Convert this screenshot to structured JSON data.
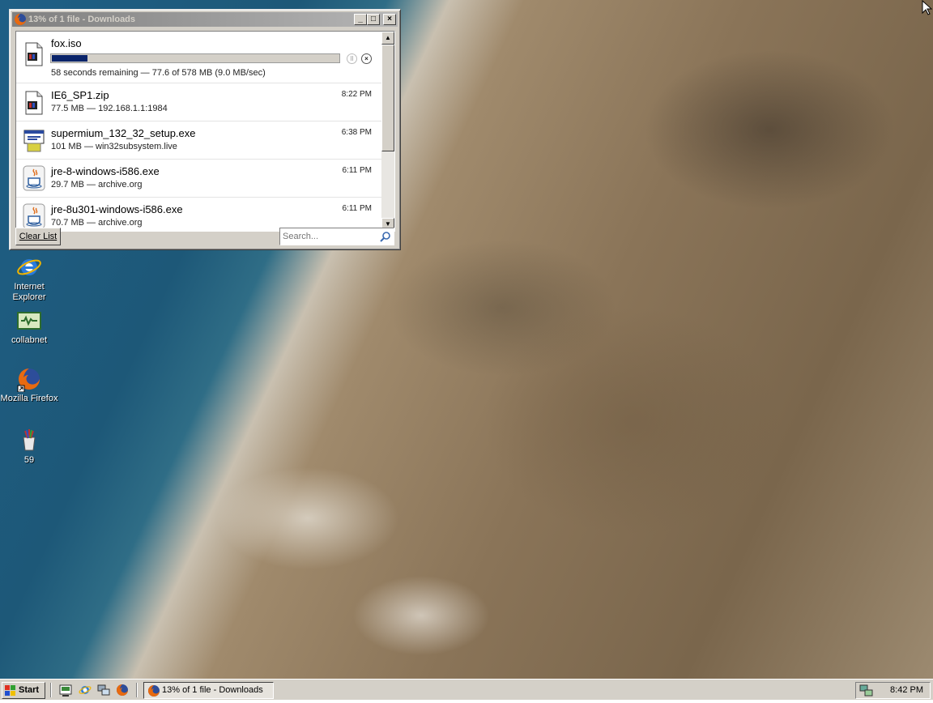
{
  "window": {
    "title": "13% of 1 file - Downloads",
    "minimize_glyph": "_",
    "maximize_glyph": "□",
    "close_glyph": "×"
  },
  "downloads": [
    {
      "name": "fox.iso",
      "status": "58 seconds remaining — 77.6 of 578 MB (9.0 MB/sec)",
      "progress_percent": 13,
      "icon": "iso-file-icon",
      "in_progress": true
    },
    {
      "name": "IE6_SP1.zip",
      "status": "77.5 MB — 192.168.1.1:1984",
      "time": "8:22 PM",
      "icon": "zip-file-icon"
    },
    {
      "name": "supermium_132_32_setup.exe",
      "status": "101 MB — win32subsystem.live",
      "time": "6:38 PM",
      "icon": "installer-icon"
    },
    {
      "name": "jre-8-windows-i586.exe",
      "status": "29.7 MB — archive.org",
      "time": "6:11 PM",
      "icon": "java-icon"
    },
    {
      "name": "jre-8u301-windows-i586.exe",
      "status": "70.7 MB — archive.org",
      "time": "6:11 PM",
      "icon": "java-icon"
    }
  ],
  "controls": {
    "pause_glyph": "II",
    "cancel_glyph": "×",
    "clear_list_label": "Clear List",
    "search_placeholder": "Search..."
  },
  "desktop_icons": [
    {
      "label": "Internet Explorer",
      "icon": "internet-explorer-icon"
    },
    {
      "label": "collabnet",
      "icon": "collabnet-icon"
    },
    {
      "label": "Mozilla Firefox",
      "icon": "firefox-icon"
    },
    {
      "label": "59",
      "icon": "paint-bucket-icon"
    }
  ],
  "taskbar": {
    "start_label": "Start",
    "task_label": "13% of 1 file - Downloads",
    "clock": "8:42 PM",
    "quick_launch": [
      "show-desktop-icon",
      "internet-explorer-icon",
      "network-icon",
      "firefox-icon"
    ]
  },
  "colors": {
    "title_inactive": "#808080",
    "progress_fill": "#0a246a",
    "chrome": "#d4d0c8"
  }
}
